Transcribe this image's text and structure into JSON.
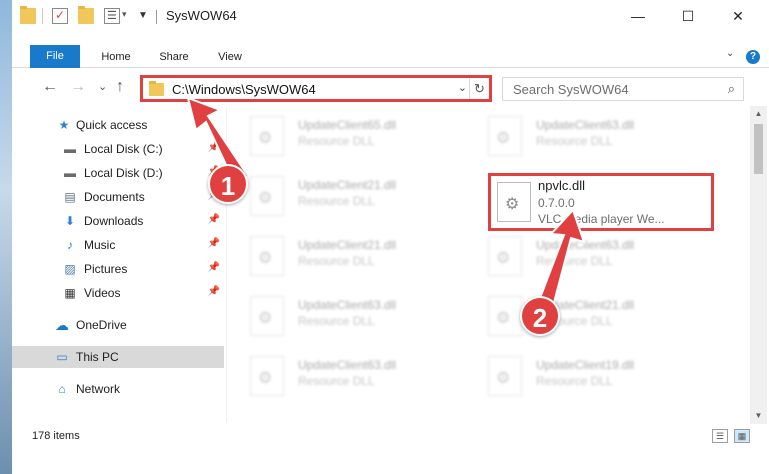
{
  "window": {
    "title": "SysWOW64"
  },
  "title_buttons": {
    "minimize": "—",
    "maximize": "☐",
    "close": "✕"
  },
  "ribbon": {
    "tabs": [
      "File",
      "Home",
      "Share",
      "View"
    ],
    "collapse": "⌄",
    "help": "?"
  },
  "address_bar": {
    "path": "C:\\Windows\\SysWOW64",
    "dropdown": "⌄",
    "refresh": "↻"
  },
  "search": {
    "placeholder": "Search SysWOW64",
    "icon": "⌕"
  },
  "nav_buttons": {
    "back": "←",
    "forward": "→",
    "recent": "⌄",
    "up": "↑"
  },
  "sidebar": {
    "items": [
      {
        "label": "Quick access",
        "icon": "star-icon",
        "glyph": "★",
        "pinned": false
      },
      {
        "label": "Local Disk (C:)",
        "icon": "drive-icon",
        "glyph": "▬",
        "pinned": true
      },
      {
        "label": "Local Disk (D:)",
        "icon": "drive-icon",
        "glyph": "▬",
        "pinned": true
      },
      {
        "label": "Documents",
        "icon": "documents-icon",
        "glyph": "▤",
        "pinned": true
      },
      {
        "label": "Downloads",
        "icon": "downloads-icon",
        "glyph": "⬇",
        "pinned": true
      },
      {
        "label": "Music",
        "icon": "music-icon",
        "glyph": "♪",
        "pinned": true
      },
      {
        "label": "Pictures",
        "icon": "pictures-icon",
        "glyph": "▨",
        "pinned": true
      },
      {
        "label": "Videos",
        "icon": "videos-icon",
        "glyph": "▦",
        "pinned": true
      },
      {
        "label": "OneDrive",
        "icon": "onedrive-icon",
        "glyph": "☁",
        "pinned": false
      },
      {
        "label": "This PC",
        "icon": "this-pc-icon",
        "glyph": "▭",
        "pinned": false,
        "selected": true
      },
      {
        "label": "Network",
        "icon": "network-icon",
        "glyph": "⌂",
        "pinned": false
      }
    ],
    "pin_glyph": "📌"
  },
  "files": {
    "left_column": [
      {
        "name": "UpdateClient65.dll",
        "desc": "Resource DLL"
      },
      {
        "name": "UpdateClient21.dll",
        "desc": "Resource DLL"
      },
      {
        "name": "UpdateClient21.dll",
        "desc": "Resource DLL"
      },
      {
        "name": "UpdateClient63.dll",
        "desc": "Resource DLL"
      },
      {
        "name": "UpdateClient63.dll",
        "desc": "Resource DLL"
      }
    ],
    "right_column": [
      {
        "name": "UpdateClient63.dll",
        "desc": "Resource DLL"
      },
      {
        "name": "UpdateClient63.dll",
        "desc": "Resource DLL"
      },
      {
        "name": "UpdateClient21.dll",
        "desc": "Resource DLL"
      },
      {
        "name": "UpdateClient19.dll",
        "desc": "Resource DLL"
      }
    ],
    "highlighted": {
      "name": "npvlc.dll",
      "version": "0.7.0.0",
      "desc": "VLC media player We..."
    }
  },
  "status_bar": {
    "count": "178 items",
    "view_details": "☰",
    "view_tiles": "▦"
  },
  "annotations": {
    "step1": "1",
    "step2": "2",
    "color": "#e04040"
  },
  "colors": {
    "accent": "#1979ca",
    "highlight_red": "#e04040",
    "selected_bg": "#d9d9d9"
  }
}
